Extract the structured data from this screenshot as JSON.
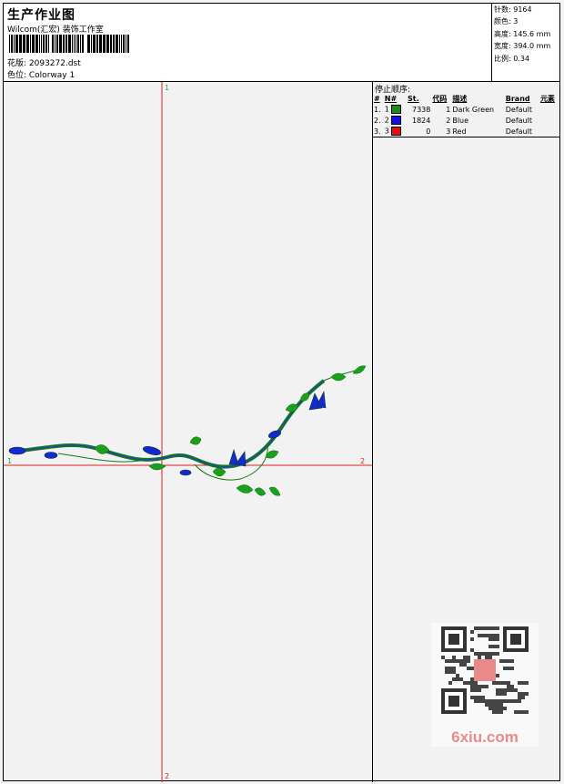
{
  "header": {
    "title": "生产作业图",
    "subtitle": "Wilcom(汇宏) 装饰工作室",
    "file_label": "花版: 2093272.dst",
    "colorway_label": "色位: Colorway 1"
  },
  "stats": {
    "stitches": "针数: 9164",
    "colors": "颜色: 3",
    "height": "高度: 145.6 mm",
    "width": "宽度: 394.0 mm",
    "scale": "比例: 0.34"
  },
  "stop_sequence": {
    "title": "停止顺序:",
    "headers": [
      "#",
      "N#",
      "St.",
      "代码",
      "描述",
      "Brand",
      "元素"
    ],
    "rows": [
      {
        "index": "1.",
        "needle": "1",
        "stitches": "7338",
        "code": "1",
        "description": "Dark Green",
        "brand": "Default",
        "color": "#1a8a1a"
      },
      {
        "index": "2.",
        "needle": "2",
        "stitches": "1824",
        "code": "2",
        "description": "Blue",
        "brand": "Default",
        "color": "#1010e0"
      },
      {
        "index": "3.",
        "needle": "3",
        "stitches": "0",
        "code": "3",
        "description": "Red",
        "brand": "Default",
        "color": "#e01010"
      }
    ]
  },
  "axes": {
    "v_top": "1",
    "v_bottom": "2",
    "h_left": "1",
    "h_right": "2"
  },
  "watermark": {
    "text": "6xiu.com"
  }
}
